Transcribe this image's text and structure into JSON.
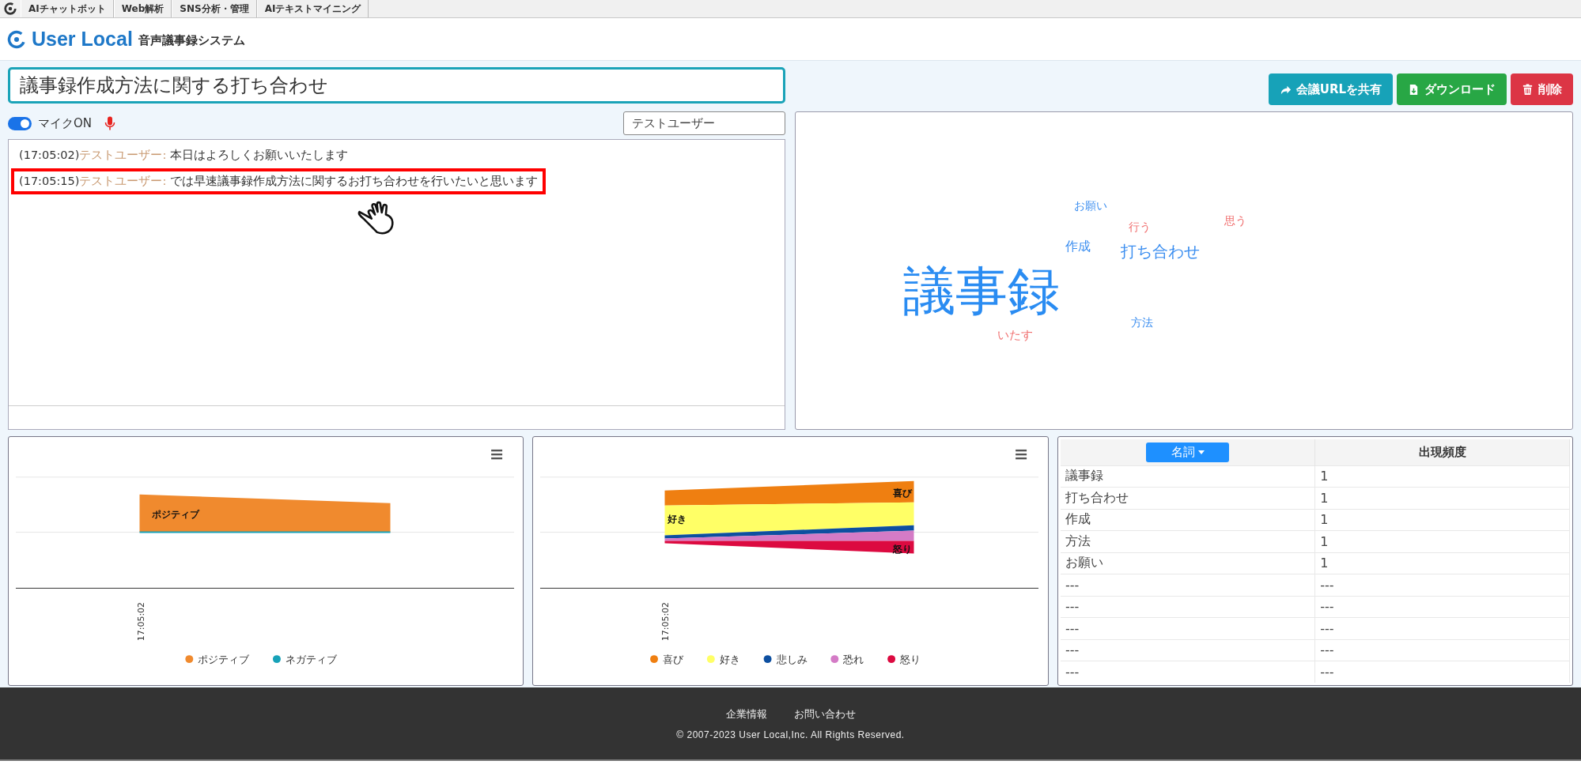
{
  "top_nav": {
    "items": [
      "AIチャットボット",
      "Web解析",
      "SNS分析・管理",
      "AIテキストマイニング"
    ]
  },
  "header": {
    "logo": "User Local",
    "system_name": "音声議事録システム"
  },
  "meeting_title": {
    "value": "議事録作成方法に関する打ち合わせ"
  },
  "actions": [
    {
      "label": "会議URLを共有",
      "kind": "share"
    },
    {
      "label": "ダウンロード",
      "kind": "download"
    },
    {
      "label": "削除",
      "kind": "delete"
    }
  ],
  "mic": {
    "label": "マイクON",
    "on": true
  },
  "speaker_field": {
    "value": "テストユーザー"
  },
  "transcript": [
    {
      "time": "(17:05:02)",
      "speaker": "テストユーザー:",
      "text": "本日はよろしくお願いいたします",
      "highlighted": false
    },
    {
      "time": "(17:05:15)",
      "speaker": "テストユーザー:",
      "text": "では早速議事録作成方法に関するお打ち合わせを行いたいと思います",
      "highlighted": true
    }
  ],
  "word_cloud": [
    {
      "word": "お願い",
      "color": "#3b8ef0"
    },
    {
      "word": "行う",
      "color": "#f06f6f"
    },
    {
      "word": "思う",
      "color": "#f06f6f"
    },
    {
      "word": "作成",
      "color": "#3b8ef0"
    },
    {
      "word": "打ち合わせ",
      "color": "#3b8ef0"
    },
    {
      "word": "議事録",
      "color": "#2a8cf2"
    },
    {
      "word": "方法",
      "color": "#3b8ef0"
    },
    {
      "word": "いたす",
      "color": "#f06f6f"
    }
  ],
  "sentiment_chart": {
    "x_label": "17:05:02",
    "series": [
      {
        "name": "ポジティブ",
        "color": "#f08a2e",
        "area_label": "ポジティブ"
      },
      {
        "name": "ネガティブ",
        "color": "#17a2b8"
      }
    ]
  },
  "emotion_chart": {
    "x_label": "17:05:02",
    "series": [
      {
        "name": "喜び",
        "color": "#ef7f11",
        "area_label": "喜び"
      },
      {
        "name": "好き",
        "color": "#ffff66",
        "area_label": "好き"
      },
      {
        "name": "悲しみ",
        "color": "#0d4fa0"
      },
      {
        "name": "恐れ",
        "color": "#d47bc6"
      },
      {
        "name": "怒り",
        "color": "#dc0a40",
        "area_label": "怒り"
      }
    ]
  },
  "word_table": {
    "filter": "名詞",
    "column_2": "出現頻度",
    "rows": [
      [
        "議事録",
        "1"
      ],
      [
        "打ち合わせ",
        "1"
      ],
      [
        "作成",
        "1"
      ],
      [
        "方法",
        "1"
      ],
      [
        "お願い",
        "1"
      ],
      [
        "---",
        "---"
      ],
      [
        "---",
        "---"
      ],
      [
        "---",
        "---"
      ],
      [
        "---",
        "---"
      ],
      [
        "---",
        "---"
      ]
    ]
  },
  "footer": {
    "links": [
      "企業情報",
      "お問い合わせ"
    ],
    "copyright": "© 2007-2023 User Local,Inc. All Rights Reserved."
  }
}
